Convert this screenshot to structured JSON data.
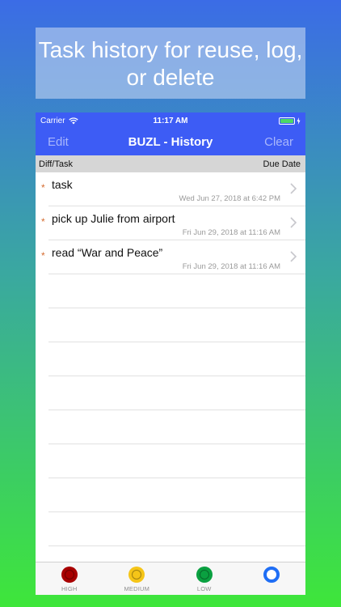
{
  "banner": {
    "text": "Task history for reuse, log, or delete"
  },
  "status_bar": {
    "carrier": "Carrier",
    "time": "11:17 AM"
  },
  "nav": {
    "left": "Edit",
    "title": "BUZL - History",
    "right": "Clear"
  },
  "columns": {
    "left": "Diff/Task",
    "right": "Due Date"
  },
  "tasks": [
    {
      "title": "task",
      "date": "Wed Jun 27, 2018 at 6:42 PM"
    },
    {
      "title": "pick up Julie from airport",
      "date": "Fri Jun 29, 2018 at 11:16 AM"
    },
    {
      "title": "read “War and Peace”",
      "date": "Fri Jun 29, 2018 at 11:16 AM"
    }
  ],
  "tabs": [
    {
      "label": "HIGH",
      "color": "#a80000"
    },
    {
      "label": "MEDIUM",
      "color": "#f5c518"
    },
    {
      "label": "LOW",
      "color": "#0aa040"
    },
    {
      "label": "",
      "color": "#1f6ef5"
    }
  ],
  "colors": {
    "nav": "#3d5cf5",
    "accent": "#1f6ef5"
  }
}
